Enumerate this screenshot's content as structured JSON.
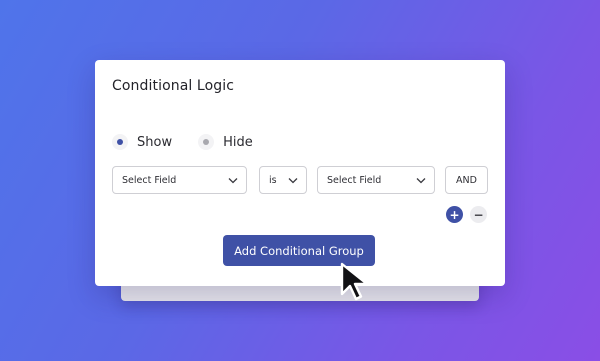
{
  "panel": {
    "title": "Conditional Logic",
    "visibility": [
      {
        "label": "Show",
        "selected": true
      },
      {
        "label": "Hide",
        "selected": false
      }
    ]
  },
  "rule": {
    "field_select": "Select Field",
    "operator_select": "is",
    "value_select": "Select Field",
    "join_button": "AND",
    "add_rule_symbol": "+",
    "remove_rule_symbol": "−"
  },
  "actions": {
    "add_group_label": "Add Conditional Group"
  },
  "colors": {
    "accent": "#3f51a6",
    "background_from": "#4f74ea",
    "background_to": "#8a4ee6"
  },
  "icons": {
    "select_arrow": "chevron-down-icon",
    "pointer": "mouse-cursor-icon"
  }
}
